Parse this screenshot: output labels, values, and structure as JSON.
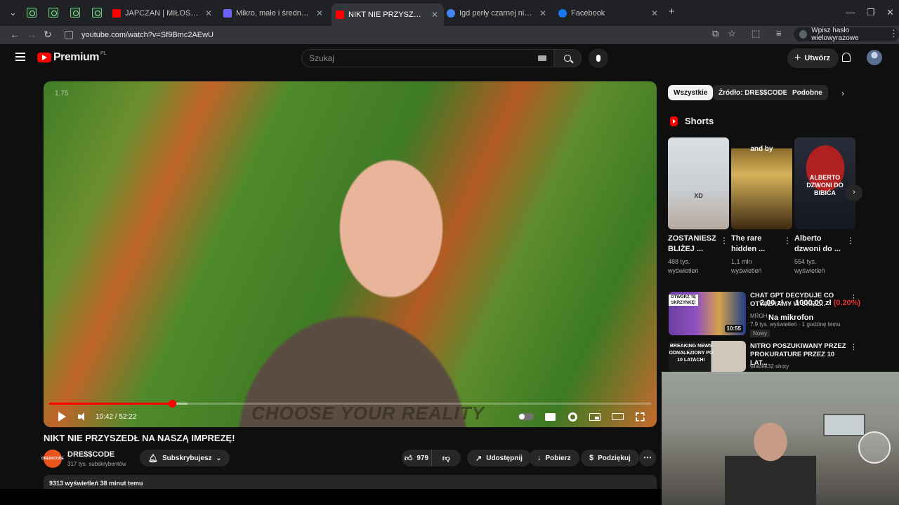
{
  "browser": {
    "tabs": [
      {
        "title": "JAPCZAN | MIŁOŚĆ Z INTERNETU",
        "favicon_color": "#ff0000"
      },
      {
        "title": "Mikro, małe i średnie przedsiębiorstwa",
        "favicon_color": "#6c63ff"
      },
      {
        "title": "NIKT NIE PRZYSZEDŁ NA NASZĄ IMPREZĘ!",
        "favicon_color": "#ff0000",
        "active": true
      },
      {
        "title": "Igd perły czarnej nidy dofinansowanie",
        "favicon_color": "#4285f4"
      },
      {
        "title": "Facebook",
        "favicon_color": "#1877f2"
      }
    ],
    "url": "youtube.com/watch?v=Sf9Bmc2AEwU",
    "password_prompt": "Wpisz hasło wielowyrazowe"
  },
  "youtube": {
    "logo_text": "Premium",
    "logo_country": "PL",
    "search_placeholder": "Szukaj",
    "create_label": "Utwórz"
  },
  "player": {
    "speed_badge": "1.75",
    "time": "10:42 / 52:22",
    "progress": 0.204,
    "buffered": 0.23,
    "watermark": "CHOOSE YOUR REALITY"
  },
  "video": {
    "title": "NIKT NIE PRZYSZEDŁ NA NASZĄ IMPREZĘ!",
    "channel": "DRE$$CODE",
    "channel_avatar_text": "DRESSCODE",
    "subscribers": "317 tys. subskrybentów",
    "subscribe_label": "Subskrybujesz",
    "likes": "979",
    "share_label": "Udostępnij",
    "download_label": "Pobierz",
    "thanks_label": "Podziękuj",
    "description_meta": "9313 wyświetleń  38 minut temu"
  },
  "sidebar": {
    "chips": [
      "Wszystkie",
      "Źródło: DRE$$CODE",
      "Podobne"
    ],
    "shorts_heading": "Shorts",
    "shorts": [
      {
        "title": "ZOSTANIESZ BLIŻEJ ...",
        "views": "488 tys. wyświetleń",
        "thumb_text": "XD"
      },
      {
        "title": "The rare hidden ...",
        "views": "1,1 mln wyświetleń",
        "thumb_text": "and by"
      },
      {
        "title": "Alberto dzwoni do ...",
        "views": "554 tys. wyświetleń",
        "thumb_text": "ALBERTO DZWONI DO BIBIĆA"
      }
    ],
    "recommended": [
      {
        "title": "CHAT GPT DECYDUJE CO OTWIERAMY W SKRZ...",
        "channel": "MRGH",
        "meta": "7,9 tys. wyświetleń · 1 godzinę temu",
        "duration": "10:55",
        "badge": "Nowy",
        "thumb_text": "OTWÓRZ TĘ SKRZYNKĘ!"
      },
      {
        "title": "NITRO POSZUKIWANY PRZEZ PROKURATURE PRZEZ 10 LAT...",
        "channel": "wladek32 shoty",
        "meta": "",
        "thumb_text": "BREAKING NEWS ODNALEZIONY PO 10 LATACH!"
      }
    ],
    "overlay_amount": "2,00 zł → 1000,00 zł",
    "overlay_change": "(0.20%)",
    "overlay_caption": "Na mikrofon"
  }
}
